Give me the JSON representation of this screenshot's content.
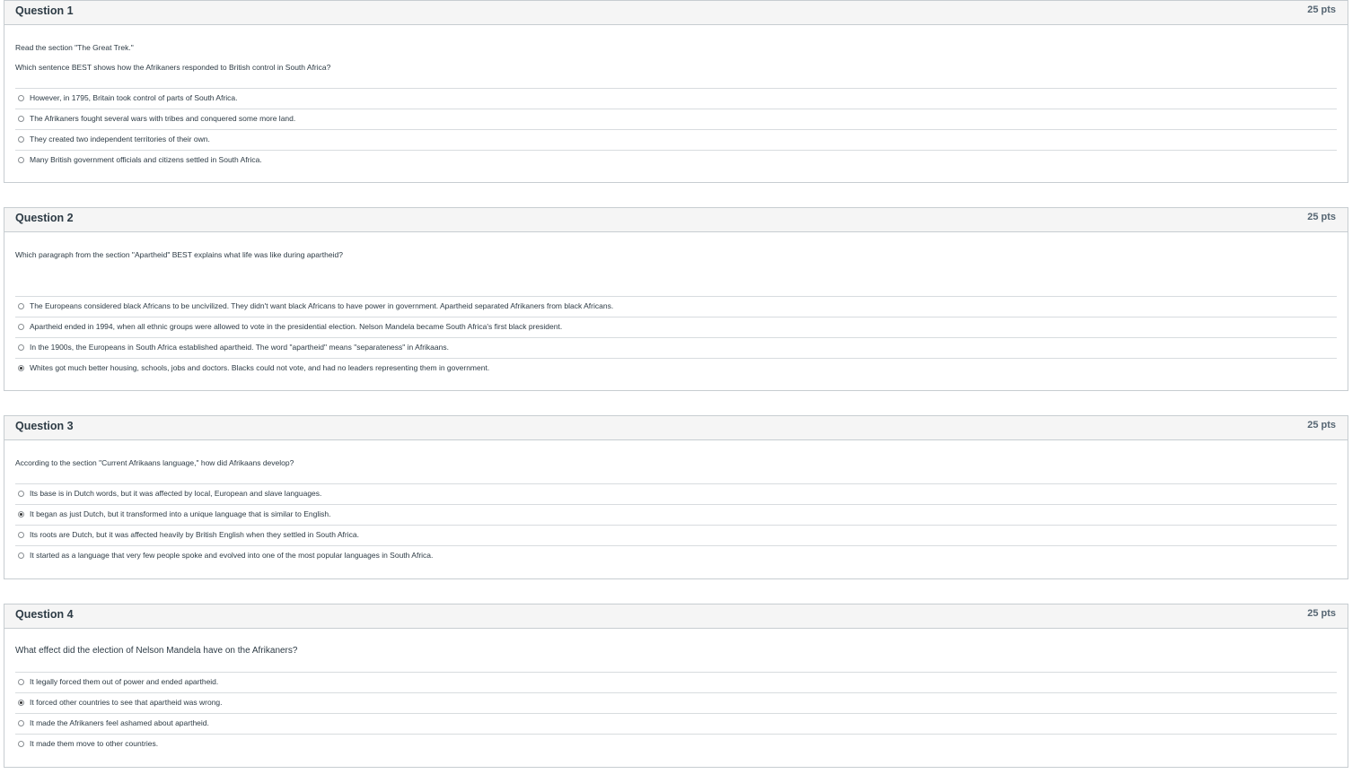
{
  "questions": [
    {
      "title": "Question 1",
      "points": "25 pts",
      "text_lines": [
        "Read the section \"The Great Trek.\"",
        "Which sentence BEST shows how the Afrikaners responded to British control in South Africa?"
      ],
      "answers": [
        {
          "label": "However, in 1795, Britain took control of parts of South Africa.",
          "selected": false
        },
        {
          "label": "The Afrikaners fought several wars with tribes and conquered some more land.",
          "selected": false
        },
        {
          "label": "They created two independent territories of their own.",
          "selected": false
        },
        {
          "label": "Many British government officials and citizens settled in South Africa.",
          "selected": false
        }
      ]
    },
    {
      "title": "Question 2",
      "points": "25 pts",
      "text_lines": [
        "Which paragraph from the section \"Apartheid\" BEST explains what life was like during apartheid?"
      ],
      "answers": [
        {
          "label": "The Europeans considered black Africans to be uncivilized. They didn't want black Africans to have power in government. Apartheid separated Afrikaners from black Africans.",
          "selected": false
        },
        {
          "label": "Apartheid ended in 1994, when all ethnic groups were allowed to vote in the presidential election. Nelson Mandela became South Africa's first black president.",
          "selected": false
        },
        {
          "label": "In the 1900s, the Europeans in South Africa established apartheid. The word \"apartheid\" means \"separateness\" in Afrikaans.",
          "selected": false
        },
        {
          "label": "Whites got much better housing, schools, jobs and doctors. Blacks could not vote, and had no leaders representing them in government.",
          "selected": true
        }
      ]
    },
    {
      "title": "Question 3",
      "points": "25 pts",
      "text_lines": [
        "According to the section \"Current Afrikaans language,\" how did Afrikaans develop?"
      ],
      "answers": [
        {
          "label": "Its base is in Dutch words, but it was affected by local, European and slave languages.",
          "selected": false
        },
        {
          "label": "It began as just Dutch, but it transformed into a unique language that is similar to English.",
          "selected": true
        },
        {
          "label": "Its roots are Dutch, but it was affected heavily by British English when they settled in South Africa.",
          "selected": false
        },
        {
          "label": "It started as a language that very few people spoke and evolved into one of the most popular languages in South Africa.",
          "selected": false
        }
      ]
    },
    {
      "title": "Question 4",
      "points": "25 pts",
      "text_lines": [
        "What effect did the election of Nelson Mandela have on the Afrikaners?"
      ],
      "answers": [
        {
          "label": "It legally forced them out of power and ended apartheid.",
          "selected": false
        },
        {
          "label": "It forced other countries to see that apartheid was wrong.",
          "selected": true
        },
        {
          "label": "It made the Afrikaners feel ashamed about apartheid.",
          "selected": false
        },
        {
          "label": "It made them move to other countries.",
          "selected": false
        }
      ]
    }
  ]
}
